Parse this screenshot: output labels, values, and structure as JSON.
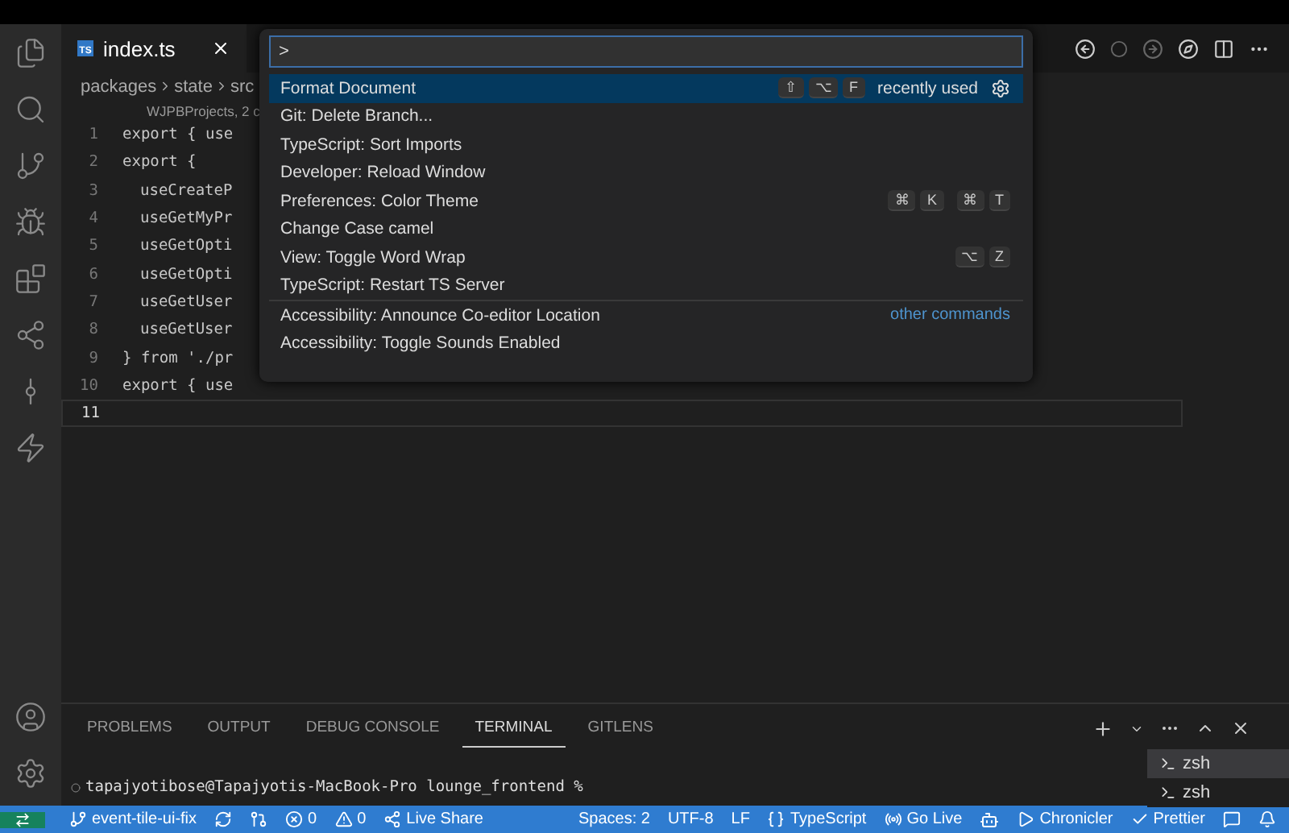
{
  "tabs": [
    {
      "label": "index.ts",
      "badge": "TS",
      "selected": true
    }
  ],
  "breadcrumb": [
    "packages",
    "state",
    "src"
  ],
  "codelens": "WJPBProjects, 2 c",
  "code": [
    {
      "n": "1",
      "text": "export { use",
      "indent": false
    },
    {
      "n": "2",
      "text": "export {",
      "indent": false
    },
    {
      "n": "3",
      "text": "useCreateP",
      "indent": true
    },
    {
      "n": "4",
      "text": "useGetMyPr",
      "indent": true
    },
    {
      "n": "5",
      "text": "useGetOpti",
      "indent": true
    },
    {
      "n": "6",
      "text": "useGetOpti",
      "indent": true
    },
    {
      "n": "7",
      "text": "useGetUser",
      "indent": true
    },
    {
      "n": "8",
      "text": "useGetUser",
      "indent": true
    },
    {
      "n": "9",
      "text": "} from './pr",
      "indent": false
    },
    {
      "n": "10",
      "text": "export { use",
      "indent": false
    },
    {
      "n": "11",
      "current": true
    }
  ],
  "palette": {
    "value": ">",
    "items": [
      {
        "label": "Format Document",
        "selected": true,
        "keys": [
          [
            "⇧",
            "⌥",
            "F"
          ]
        ],
        "note": "recently used",
        "gear": true
      },
      {
        "label": "Git: Delete Branch...",
        "selected": false
      },
      {
        "label": "TypeScript: Sort Imports",
        "selected": false
      },
      {
        "label": "Developer: Reload Window",
        "selected": false
      },
      {
        "label": "Preferences: Color Theme",
        "selected": false,
        "keys": [
          [
            "⌘",
            "K"
          ],
          [
            "⌘",
            "T"
          ]
        ]
      },
      {
        "label": "Change Case camel",
        "selected": false
      },
      {
        "label": "View: Toggle Word Wrap",
        "selected": false,
        "keys": [
          [
            "⌥",
            "Z"
          ]
        ]
      },
      {
        "label": "TypeScript: Restart TS Server",
        "selected": false
      },
      {
        "label": "Accessibility: Announce Co-editor Location",
        "selected": false,
        "separator": true,
        "link": "other commands"
      },
      {
        "label": "Accessibility: Toggle Sounds Enabled",
        "selected": false
      }
    ]
  },
  "panel": {
    "tabs": [
      {
        "label": "PROBLEMS",
        "selected": false
      },
      {
        "label": "OUTPUT",
        "selected": false
      },
      {
        "label": "DEBUG CONSOLE",
        "selected": false
      },
      {
        "label": "TERMINAL",
        "selected": true
      },
      {
        "label": "GITLENS",
        "selected": false
      }
    ],
    "prompt": "tapajyotibose@Tapajyotis-MacBook-Pro lounge_frontend %",
    "terminals": [
      {
        "label": "zsh",
        "selected": true
      },
      {
        "label": "zsh",
        "selected": false
      }
    ]
  },
  "status_bar": {
    "left": [
      {
        "kind": "branch",
        "text": "event-tile-ui-fix"
      },
      {
        "kind": "sync"
      },
      {
        "kind": "graph"
      },
      {
        "kind": "errors",
        "text": "0"
      },
      {
        "kind": "warnings",
        "text": "0"
      },
      {
        "kind": "liveshare",
        "text": "Live Share"
      }
    ],
    "right": [
      {
        "kind": "text",
        "text": "Spaces: 2"
      },
      {
        "kind": "text",
        "text": "UTF-8"
      },
      {
        "kind": "text",
        "text": "LF"
      },
      {
        "kind": "lang",
        "text": "TypeScript"
      },
      {
        "kind": "golive",
        "text": "Go Live"
      },
      {
        "kind": "copilot"
      },
      {
        "kind": "play",
        "text": "Chronicler"
      },
      {
        "kind": "check",
        "text": "Prettier"
      },
      {
        "kind": "feedback"
      },
      {
        "kind": "bell"
      }
    ]
  }
}
